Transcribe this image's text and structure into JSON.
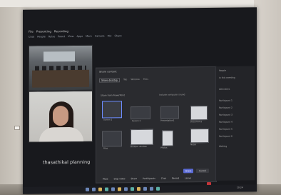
{
  "app": {
    "menu": [
      "File",
      "Presenting",
      "Recording"
    ],
    "toolbar": [
      "Chat",
      "People",
      "Raise",
      "React",
      "View",
      "Apps",
      "More",
      "Camera",
      "Mic",
      "Share"
    ]
  },
  "gallery": {
    "caption": "thasathikal planning"
  },
  "share_dialog": {
    "title": "Share content",
    "tabs": [
      "Share desktop",
      "Tab",
      "Window",
      "Files"
    ],
    "section_label": "Share from PowerPoint",
    "include_label": "Include computer sound",
    "thumbnails": [
      {
        "label": "Screen 1",
        "light": false
      },
      {
        "label": "Screen 2",
        "light": false
      },
      {
        "label": "Presentation1",
        "light": false
      },
      {
        "label": "Document1",
        "light": true
      },
      {
        "label": "Browser window",
        "light": true
      },
      {
        "label": "Files",
        "light": false
      },
      {
        "label": "Photos",
        "light": true
      },
      {
        "label": "Notes",
        "light": true
      }
    ],
    "share_button": "Share",
    "cancel_button": "Cancel"
  },
  "side_panel": {
    "items": [
      "People",
      "In this meeting",
      "Attendees",
      "Participant 1",
      "Participant 2",
      "Participant 3",
      "Participant 4",
      "Participant 5",
      "Participant 6",
      "Waiting"
    ]
  },
  "meeting_controls": [
    "Mute",
    "Stop video",
    "Share",
    "Participants",
    "Chat",
    "Record",
    "Leave"
  ],
  "taskbar": {
    "clock": "10:24"
  },
  "colors": {
    "accent": "#5b6bd6",
    "danger": "#c2353a",
    "screen_bg": "#18191d"
  }
}
